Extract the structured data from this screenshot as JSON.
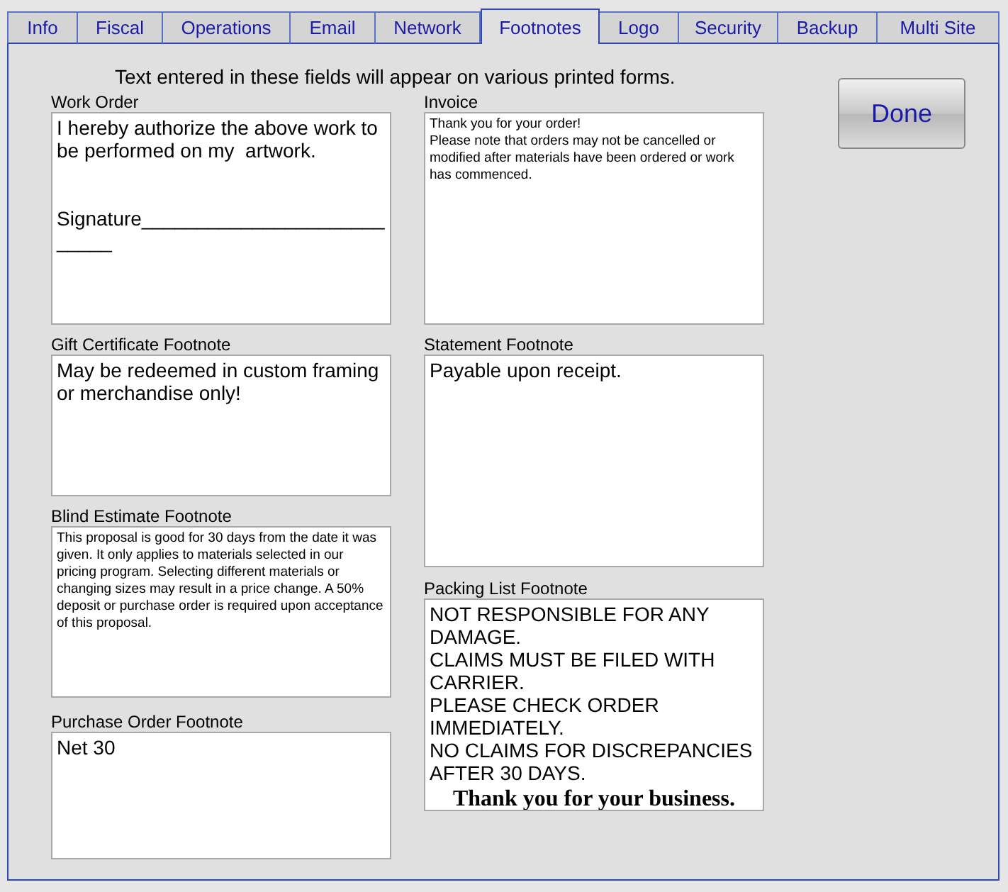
{
  "tabs": [
    {
      "label": "Info",
      "selected": false
    },
    {
      "label": "Fiscal",
      "selected": false
    },
    {
      "label": "Operations",
      "selected": false
    },
    {
      "label": "Email",
      "selected": false
    },
    {
      "label": "Network",
      "selected": false
    },
    {
      "label": "Footnotes",
      "selected": true
    },
    {
      "label": "Logo",
      "selected": false
    },
    {
      "label": "Security",
      "selected": false
    },
    {
      "label": "Backup",
      "selected": false
    },
    {
      "label": "Multi Site",
      "selected": false
    }
  ],
  "intro": "Text entered in these fields will appear on various printed forms.",
  "done_button": "Done",
  "left_fields": [
    {
      "label": "Work Order",
      "lines": [
        {
          "kind": "normal",
          "text": "I hereby authorize the above work to be performed on my  artwork.\n\n\nSignature___________________________"
        }
      ]
    },
    {
      "label": "Gift Certificate Footnote",
      "lines": [
        {
          "kind": "normal",
          "text": "May be redeemed in custom framing or merchandise only!"
        }
      ]
    },
    {
      "label": "Blind Estimate Footnote",
      "lines": [
        {
          "kind": "small",
          "text": "This proposal is good for 30 days from the date it was given. It only applies to materials selected in our pricing program. Selecting different materials or changing sizes may result in a price change. A 50% deposit or purchase order is required upon acceptance of this proposal."
        }
      ]
    },
    {
      "label": "Purchase Order Footnote",
      "lines": [
        {
          "kind": "normal",
          "text": "Net 30"
        }
      ]
    }
  ],
  "right_fields": [
    {
      "label": "Invoice",
      "lines": [
        {
          "kind": "small",
          "text": "Thank you for your order!\nPlease note that orders may not be cancelled or modified after materials have been ordered or work has commenced."
        }
      ]
    },
    {
      "label": "Statement Footnote",
      "lines": [
        {
          "kind": "normal",
          "text": "Payable upon receipt."
        }
      ]
    },
    {
      "label": "Packing List Footnote",
      "lines": [
        {
          "kind": "normal",
          "text": "NOT RESPONSIBLE FOR ANY DAMAGE.\nCLAIMS MUST BE FILED WITH CARRIER.\nPLEASE CHECK ORDER IMMEDIATELY.\nNO CLAIMS FOR DISCREPANCIES\nAFTER 30 DAYS."
        },
        {
          "kind": "emphasis",
          "text": "Thank you for your business."
        }
      ]
    }
  ]
}
